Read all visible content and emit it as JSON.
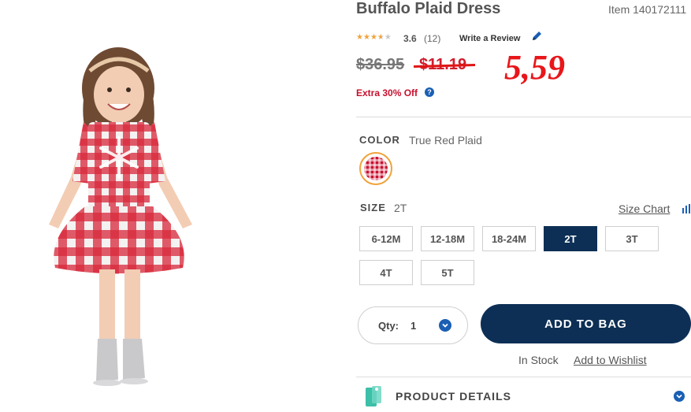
{
  "product": {
    "title": "Buffalo Plaid Dress",
    "item_number": "Item 140172111",
    "rating": "3.6",
    "review_count": "(12)",
    "write_review": "Write a Review",
    "stars_filled": 3.6
  },
  "price": {
    "original": "$36.95",
    "sale": "$11.19",
    "handwritten": "5,59",
    "extra_offer": "Extra 30% Off",
    "help_glyph": "?"
  },
  "color": {
    "label": "COLOR",
    "value": "True Red Plaid"
  },
  "size": {
    "label": "SIZE",
    "value": "2T",
    "size_chart": "Size Chart",
    "options": [
      "6-12M",
      "12-18M",
      "18-24M",
      "2T",
      "3T",
      "4T",
      "5T"
    ],
    "selected": "2T"
  },
  "quantity": {
    "label": "Qty:",
    "value": "1"
  },
  "actions": {
    "add_to_bag": "ADD TO BAG",
    "in_stock": "In Stock",
    "wishlist": "Add to Wishlist"
  },
  "details": {
    "label": "PRODUCT DETAILS"
  },
  "colors": {
    "navy": "#0d2f55",
    "sale_red": "#d01e2e",
    "accent_blue": "#1a5fb4",
    "star_orange": "#f0a23c"
  },
  "icons": [
    "pencil-icon",
    "help-icon",
    "bar-chart-icon",
    "chevron-down-icon",
    "hanger-tag-icon"
  ]
}
